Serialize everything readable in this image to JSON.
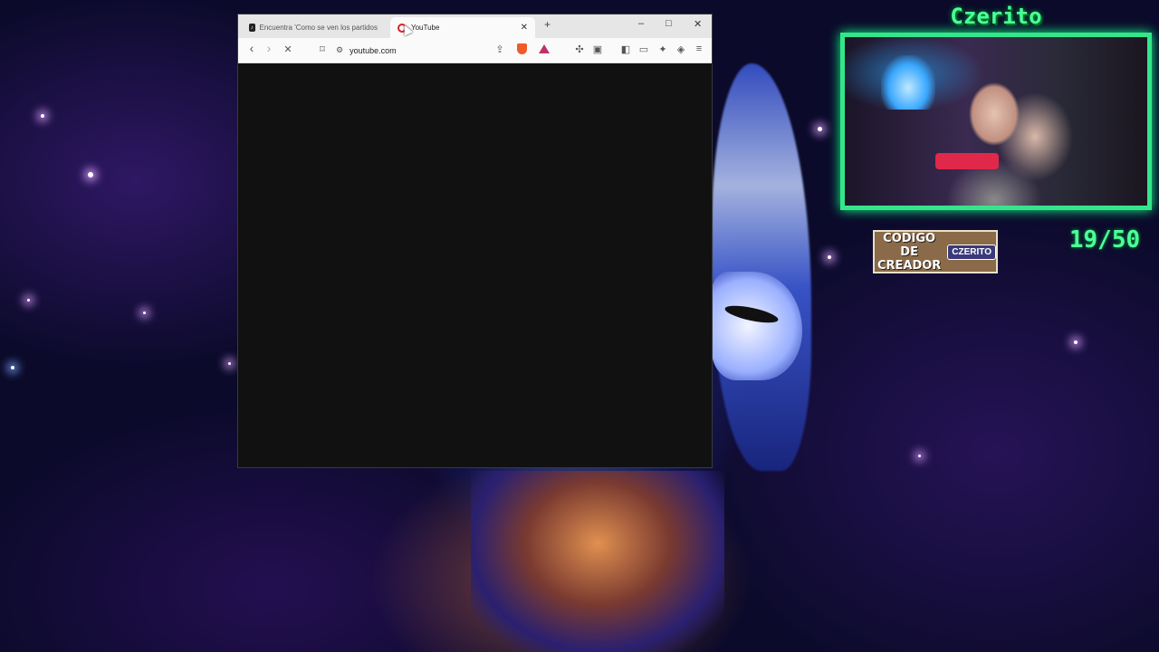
{
  "browser": {
    "tabs": [
      {
        "title": "Encuentra 'Como se ven los partidos",
        "icon": "tiktok-icon",
        "active": false
      },
      {
        "title": "YouTube",
        "icon": "youtube-icon",
        "active": true
      }
    ],
    "new_tab_symbol": "+",
    "window_controls": {
      "minimize": "–",
      "maximize": "□",
      "close": "✕"
    },
    "nav": {
      "back": "‹",
      "forward": "›",
      "stop": "✕"
    },
    "url": "youtube.com",
    "toolbar_icons": [
      "bookmark-icon",
      "site-settings-icon",
      "share-icon",
      "brave-shields-icon",
      "brave-rewards-icon",
      "extensions-icon",
      "tab-grid-icon",
      "sidebar-icon",
      "wallet-icon",
      "leo-ai-icon",
      "vpn-icon",
      "menu-icon"
    ]
  },
  "overlay": {
    "streamer_name": "Czerito",
    "creator_code_label": "CODIGO DE CREADOR",
    "creator_code_name": "CZERITO",
    "counter": "19/50",
    "accent_color": "#4dff9a"
  }
}
